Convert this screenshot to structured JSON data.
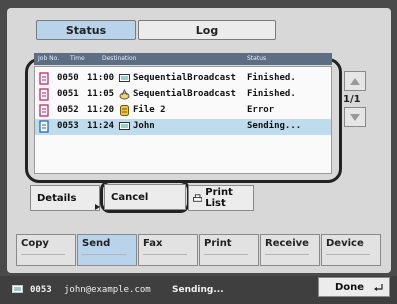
{
  "tabs": {
    "status": "Status",
    "log": "Log"
  },
  "columns": {
    "job_no": "Job No.",
    "time": "Time",
    "destination": "Destination",
    "status": "Status"
  },
  "jobs": [
    {
      "job_no": "0050",
      "time": "11:00",
      "destination": "SequentialBroadcast",
      "status": "Finished.",
      "dest_icon": "monitor-icon"
    },
    {
      "job_no": "0051",
      "time": "11:05",
      "destination": "SequentialBroadcast",
      "status": "Finished.",
      "dest_icon": "broadcast-icon"
    },
    {
      "job_no": "0052",
      "time": "11:20",
      "destination": "File 2",
      "status": "Error",
      "dest_icon": "file-icon"
    },
    {
      "job_no": "0053",
      "time": "11:24",
      "destination": "John",
      "status": "Sending...",
      "dest_icon": "monitor-icon"
    }
  ],
  "pagination": {
    "page": "1/1"
  },
  "actions": {
    "details": "Details",
    "cancel": "Cancel",
    "print_list": "Print List"
  },
  "nav": {
    "copy": "Copy",
    "send": "Send",
    "fax": "Fax",
    "print": "Print",
    "receive": "Receive",
    "device": "Device"
  },
  "status_bar": {
    "job_no": "0053",
    "address": "john@example.com",
    "state": "Sending...",
    "done": "Done"
  },
  "colors": {
    "accent": "#b9d4ea",
    "selected_row": "#bfdcec",
    "panel": "#d8d8d8",
    "bezel": "#4a4a4a"
  }
}
